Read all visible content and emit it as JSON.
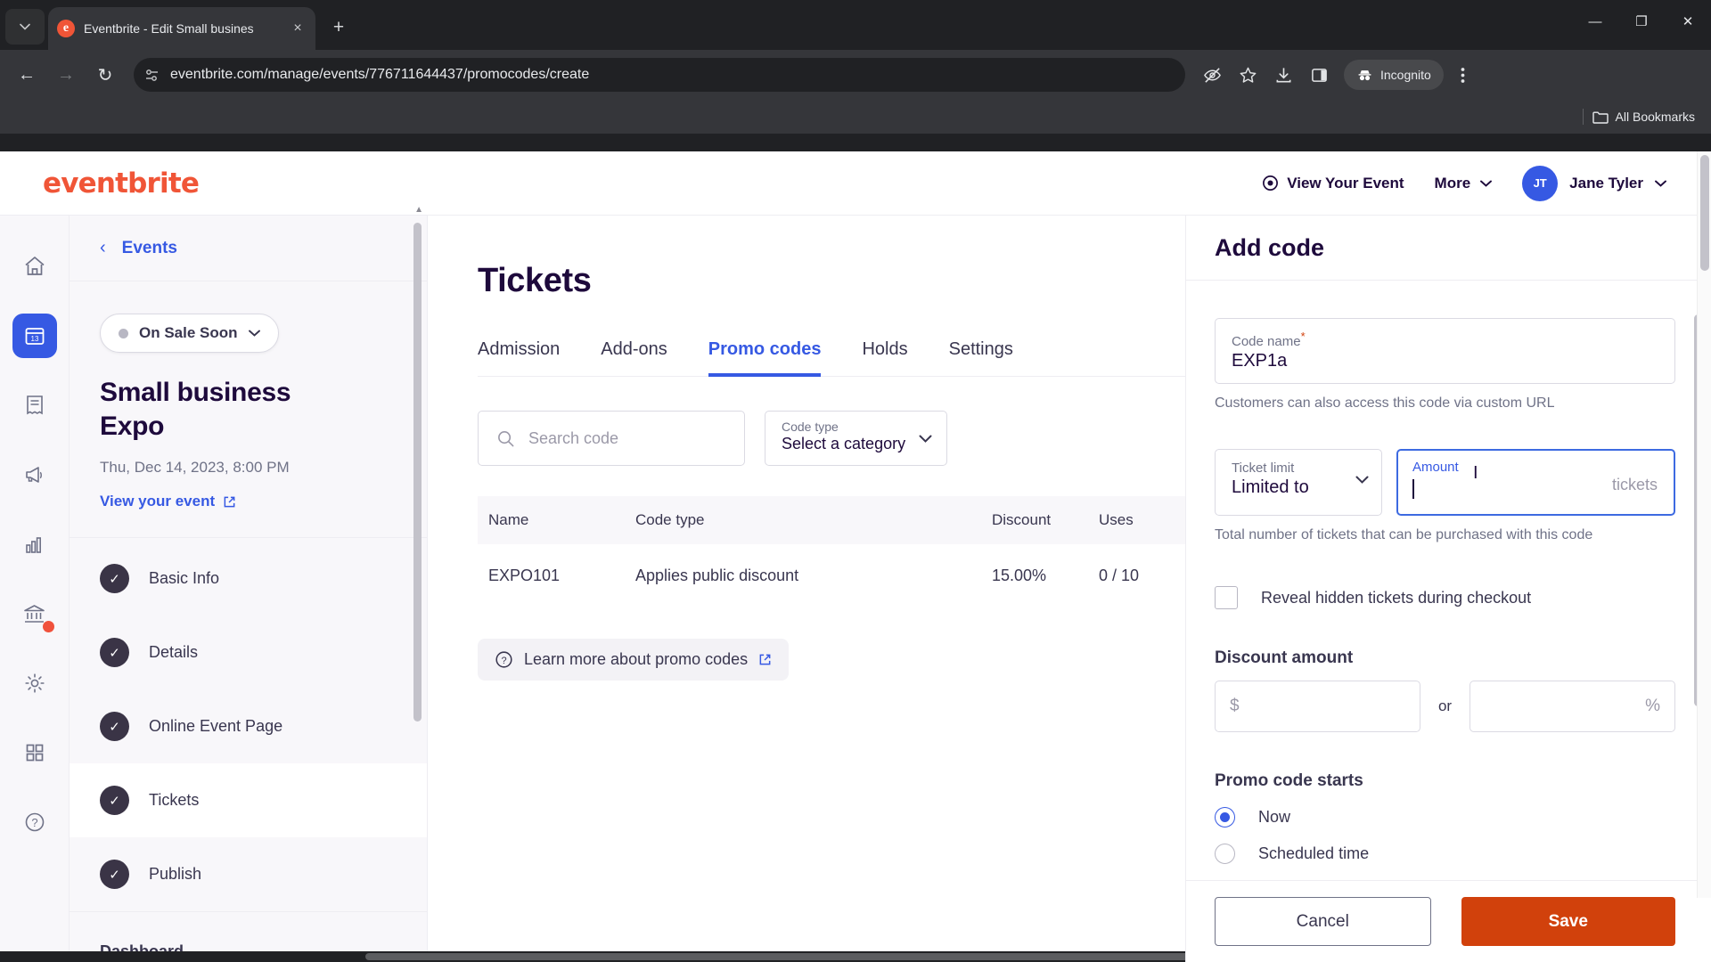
{
  "browser": {
    "tab": {
      "title": "Eventbrite - Edit Small busines",
      "favicon": "eventbrite-favicon",
      "close_label": "×"
    },
    "new_tab_label": "+",
    "window": {
      "minimize": "—",
      "maximize": "❐",
      "close": "✕"
    },
    "nav": {
      "back": "←",
      "forward": "→",
      "reload": "↻"
    },
    "url": "eventbrite.com/manage/events/776711644437/promocodes/create",
    "profile_label": "Incognito",
    "bookmarks_label": "All Bookmarks",
    "icons": {
      "tab_search": "chevron-down-icon",
      "site_settings": "site-settings-icon",
      "tracking": "eye-off-icon",
      "bookmark": "star-icon",
      "downloads": "download-icon",
      "side_panel": "side-panel-icon",
      "menu": "kebab-menu-icon"
    }
  },
  "header": {
    "logo": "eventbrite",
    "view_event": "View Your Event",
    "more": "More",
    "user_initials": "JT",
    "user_name": "Jane Tyler"
  },
  "rail": {
    "items": [
      {
        "name": "home",
        "icon": "home-icon",
        "active": false
      },
      {
        "name": "events",
        "icon": "calendar-icon",
        "active": true
      },
      {
        "name": "orders",
        "icon": "receipt-icon",
        "active": false
      },
      {
        "name": "marketing",
        "icon": "megaphone-icon",
        "active": false
      },
      {
        "name": "reports",
        "icon": "bar-chart-icon",
        "active": false
      },
      {
        "name": "finance",
        "icon": "bank-icon",
        "active": false,
        "badge": true
      },
      {
        "name": "settings",
        "icon": "gear-icon",
        "active": false
      },
      {
        "name": "apps",
        "icon": "grid-icon",
        "active": false
      },
      {
        "name": "help",
        "icon": "help-circle-icon",
        "active": false
      }
    ]
  },
  "sidebar": {
    "back_label": "Events",
    "status": "On Sale Soon",
    "event_title": "Small business Expo",
    "event_date": "Thu, Dec 14, 2023, 8:00 PM",
    "view_event_link": "View your event",
    "steps": [
      {
        "label": "Basic Info",
        "done": true,
        "active": false
      },
      {
        "label": "Details",
        "done": true,
        "active": false
      },
      {
        "label": "Online Event Page",
        "done": true,
        "active": false
      },
      {
        "label": "Tickets",
        "done": true,
        "active": true
      },
      {
        "label": "Publish",
        "done": true,
        "active": false
      }
    ],
    "footer_item": "Dashboard"
  },
  "main": {
    "title": "Tickets",
    "tabs": [
      {
        "label": "Admission",
        "selected": false
      },
      {
        "label": "Add-ons",
        "selected": false
      },
      {
        "label": "Promo codes",
        "selected": true
      },
      {
        "label": "Holds",
        "selected": false
      },
      {
        "label": "Settings",
        "selected": false
      }
    ],
    "search": {
      "placeholder": "Search code",
      "value": "",
      "icon": "search-icon"
    },
    "code_type_filter": {
      "label": "Code type",
      "value": "Select a category"
    },
    "table": {
      "columns": [
        "Name",
        "Code type",
        "Discount",
        "Uses"
      ],
      "rows": [
        {
          "name": "EXPO101",
          "code_type": "Applies public discount",
          "discount": "15.00%",
          "uses": "0 / 10"
        }
      ]
    },
    "learn_more": "Learn more about promo codes"
  },
  "drawer": {
    "title": "Add code",
    "code_name": {
      "label": "Code name",
      "required_marker": "*",
      "value": "EXP1a"
    },
    "code_name_helper": "Customers can also access this code via custom URL",
    "ticket_limit": {
      "label": "Ticket limit",
      "value": "Limited to"
    },
    "amount": {
      "label": "Amount",
      "value": "",
      "unit": "tickets",
      "focused": true
    },
    "amount_helper": "Total number of tickets that can be purchased with this code",
    "reveal_hidden": {
      "label": "Reveal hidden tickets during checkout",
      "checked": false
    },
    "discount_section_title": "Discount amount",
    "discount_currency": {
      "placeholder": "$",
      "value": ""
    },
    "discount_or": "or",
    "discount_percent": {
      "placeholder": "%",
      "value": ""
    },
    "starts_section_title": "Promo code starts",
    "starts_options": [
      {
        "label": "Now",
        "selected": true
      },
      {
        "label": "Scheduled time",
        "selected": false
      }
    ],
    "cancel_label": "Cancel",
    "save_label": "Save"
  },
  "colors": {
    "brand_orange": "#f05537",
    "save_orange": "#d1410c",
    "accent_blue": "#3659e3",
    "dark_purple": "#1e0a3c"
  }
}
